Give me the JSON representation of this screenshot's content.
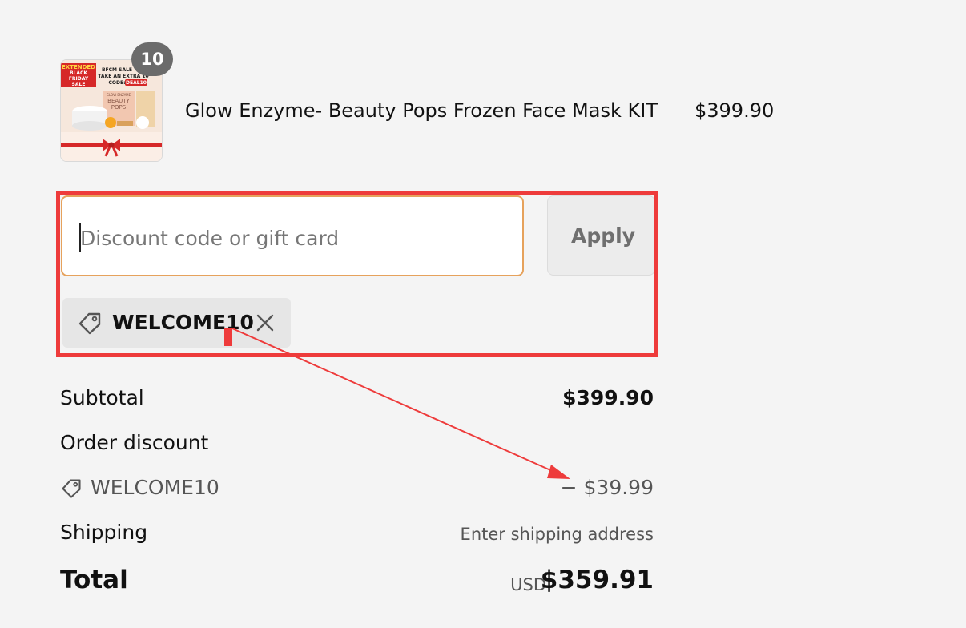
{
  "product": {
    "quantity": "10",
    "name": "Glow Enzyme- Beauty Pops Frozen Face Mask KIT",
    "price": "$399.90",
    "image": {
      "badge_line1": "EXTENDED",
      "badge_line2": "BLACK",
      "badge_line3": "FRIDAY",
      "badge_line4": "SALE",
      "promo_line1": "BFCM SALE",
      "promo_line2": "TAKE AN EXTRA 10",
      "promo_line3": "CODE:",
      "promo_code": "DEAL10",
      "box_brand": "GLOW ENZYME",
      "box_title1": "BEAUTY",
      "box_title2": "POPS"
    }
  },
  "discount": {
    "placeholder": "Discount code or gift card",
    "value": "",
    "apply_label": "Apply",
    "applied_code": "WELCOME10"
  },
  "summary": {
    "subtotal_label": "Subtotal",
    "subtotal_value": "$399.90",
    "order_discount_label": "Order discount",
    "discount_code": "WELCOME10",
    "discount_value": "− $39.99",
    "shipping_label": "Shipping",
    "shipping_value": "Enter shipping address",
    "total_label": "Total",
    "total_currency": "USD",
    "total_value": "$359.91"
  },
  "colors": {
    "annotation": "#ee3b3b",
    "input_focus": "#e6a25c",
    "page_bg": "#f4f4f4"
  }
}
